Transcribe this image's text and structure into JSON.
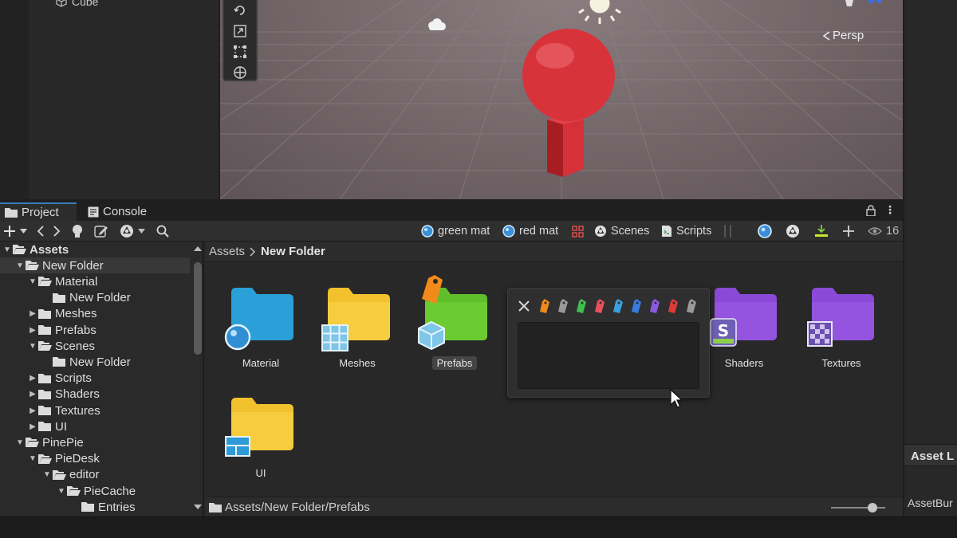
{
  "hierarchy": {
    "item_cube": "Cube"
  },
  "scene": {
    "projection": "Persp"
  },
  "tabs": {
    "project": "Project",
    "console": "Console"
  },
  "toolbar": {
    "favorites": [
      {
        "label": "green mat",
        "icon": "material-sphere-icon"
      },
      {
        "label": "red mat",
        "icon": "material-sphere-icon"
      },
      {
        "label": "Scenes",
        "icon": "unity-logo-icon"
      },
      {
        "label": "Scripts",
        "icon": "script-icon"
      }
    ],
    "visibility_count": "16"
  },
  "tree": [
    {
      "label": "Assets",
      "depth": 0,
      "expanded": true,
      "bold": true
    },
    {
      "label": "New Folder",
      "depth": 1,
      "expanded": true,
      "selected": true
    },
    {
      "label": "Material",
      "depth": 2,
      "expanded": true
    },
    {
      "label": "New Folder",
      "depth": 3,
      "leaf": true
    },
    {
      "label": "Meshes",
      "depth": 2,
      "expanded": false
    },
    {
      "label": "Prefabs",
      "depth": 2,
      "expanded": false
    },
    {
      "label": "Scenes",
      "depth": 2,
      "expanded": true
    },
    {
      "label": "New Folder",
      "depth": 3,
      "leaf": true
    },
    {
      "label": "Scripts",
      "depth": 2,
      "expanded": false
    },
    {
      "label": "Shaders",
      "depth": 2,
      "expanded": false
    },
    {
      "label": "Textures",
      "depth": 2,
      "expanded": false
    },
    {
      "label": "UI",
      "depth": 2,
      "expanded": false
    },
    {
      "label": "PinePie",
      "depth": 1,
      "expanded": true
    },
    {
      "label": "PieDesk",
      "depth": 2,
      "expanded": true
    },
    {
      "label": "editor",
      "depth": 3,
      "expanded": true
    },
    {
      "label": "PieCache",
      "depth": 4,
      "expanded": true
    },
    {
      "label": "Entries",
      "depth": 5,
      "leaf": true
    }
  ],
  "breadcrumb": {
    "root": "Assets",
    "current": "New Folder"
  },
  "assets": {
    "material": {
      "label": "Material",
      "color": "#2b9fd8",
      "badge": "material-sphere-icon"
    },
    "meshes": {
      "label": "Meshes",
      "color": "#f2c12e",
      "badge": "mesh-grid-icon"
    },
    "prefabs": {
      "label": "Prefabs",
      "color": "#5fbf2a",
      "badge": "prefab-cube-icon",
      "tag": "tag-icon",
      "selected": true
    },
    "shaders": {
      "label": "Shaders",
      "color": "#8a49d6",
      "badge": "shader-icon"
    },
    "textures": {
      "label": "Textures",
      "color": "#8a49d6",
      "badge": "texture-checker-icon"
    },
    "ui": {
      "label": "UI",
      "color": "#f2c12e",
      "badge": "ui-layout-icon"
    }
  },
  "tag_popup": {
    "colors": [
      "#f08a1c",
      "#9a9a9a",
      "#3fbf4f",
      "#e8505b",
      "#3aa0e0",
      "#3a7be0",
      "#8a5be0",
      "#e03a3a",
      "#9a9a9a"
    ]
  },
  "status": {
    "path": "Assets/New Folder/Prefabs"
  },
  "right_panel": {
    "header": "Asset L",
    "field": "AssetBur"
  }
}
